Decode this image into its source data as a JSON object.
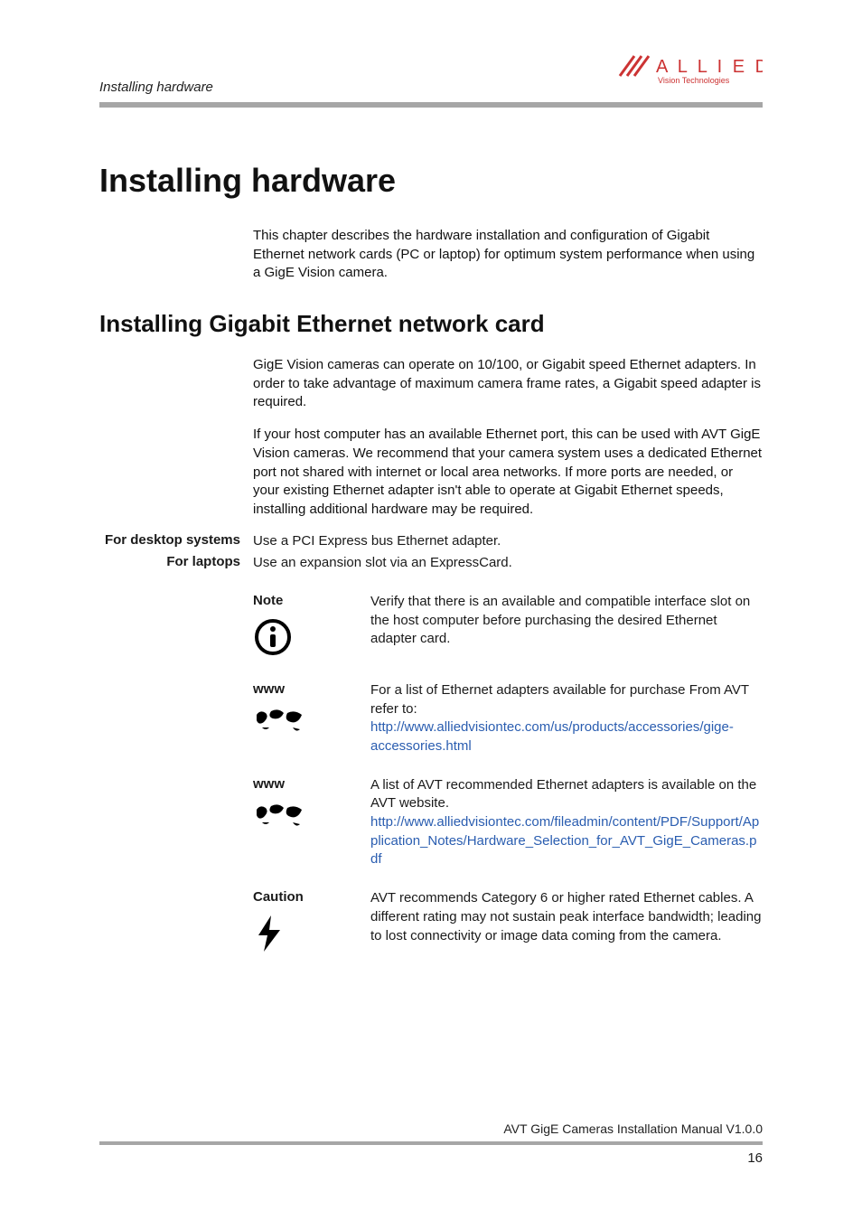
{
  "header": {
    "breadcrumb": "Installing hardware",
    "logo_top": "A L L I E D",
    "logo_bottom": "Vision Technologies"
  },
  "titles": {
    "main": "Installing hardware",
    "section": "Installing Gigabit Ethernet network card"
  },
  "intro": "This chapter describes the hardware installation and configuration of Gigabit Ethernet network cards (PC or laptop) for optimum system performance when using a GigE Vision camera.",
  "paras": {
    "p1": "GigE Vision cameras can operate on 10/100, or Gigabit speed Ethernet adapters. In order to take advantage of maximum camera frame rates, a Gigabit speed adapter is required.",
    "p2": "If your host computer has an available Ethernet port, this can be used with AVT GigE Vision cameras. We recommend that your camera system uses a dedicated Ethernet port not shared with internet or local area networks. If more ports are needed, or your existing Ethernet adapter isn't able to operate at Gigabit Ethernet speeds, installing additional hardware may be required."
  },
  "rows": {
    "desktop_label": "For desktop systems",
    "desktop_value": "Use a PCI Express bus Ethernet adapter.",
    "laptop_label": "For laptops",
    "laptop_value": "Use an expansion slot via an ExpressCard."
  },
  "callouts": {
    "note_title": "Note",
    "note_body": "Verify that there is an available and compatible interface slot on the host computer before purchasing the desired Ethernet adapter card.",
    "www1_title": "www",
    "www1_text": "For a list of Ethernet adapters available for purchase From AVT refer to:",
    "www1_link": "http://www.alliedvisiontec.com/us/products/accessories/gige-accessories.html",
    "www2_title": "www",
    "www2_text": "A list of AVT recommended Ethernet adapters is available on the AVT website.",
    "www2_link": "http://www.alliedvisiontec.com/fileadmin/content/PDF/Support/Application_Notes/Hardware_Selection_for_AVT_GigE_Cameras.pdf",
    "caution_title": "Caution",
    "caution_body": "AVT recommends Category 6 or higher rated Ethernet cables. A different rating may not sustain peak interface bandwidth; leading to lost connectivity or image data coming from the camera."
  },
  "footer": {
    "text": "AVT GigE Cameras Installation Manual V1.0.0",
    "page": "16"
  }
}
